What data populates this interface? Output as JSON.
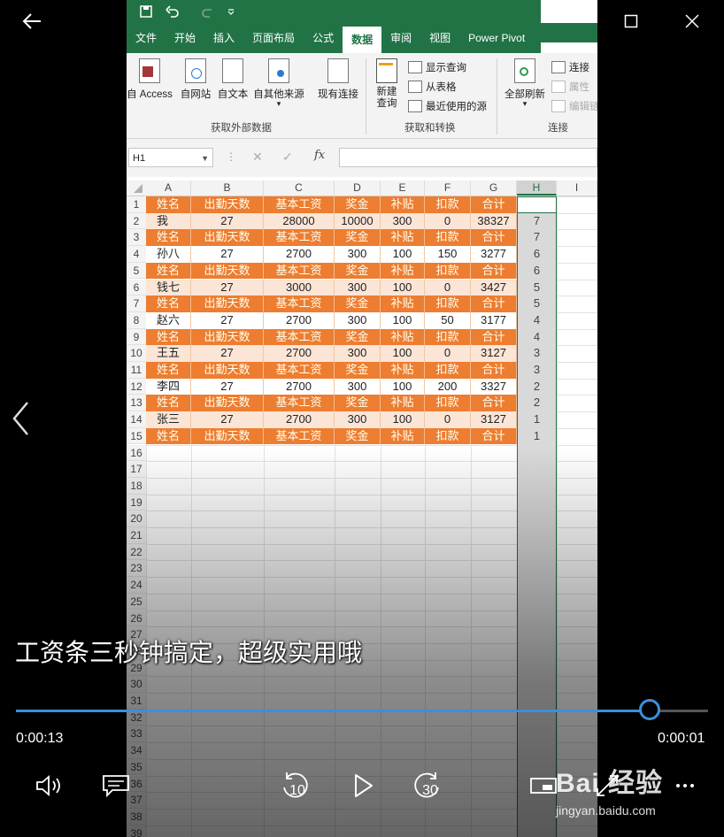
{
  "player": {
    "subtitle": "工资条三秒钟搞定，超级实用哦",
    "elapsed": "0:00:13",
    "remaining": "0:00:01",
    "progress": 0.915,
    "accent_color": "#3a8fdd",
    "skip_back": "10",
    "skip_forward": "30"
  },
  "watermark": {
    "logo": "Bai 经验",
    "url": "jingyan.baidu.com"
  },
  "excel": {
    "tabs": [
      "文件",
      "开始",
      "插入",
      "页面布局",
      "公式",
      "数据",
      "审阅",
      "视图",
      "Power Pivot"
    ],
    "active_tab": "数据",
    "ribbon": {
      "get_external": {
        "buttons": [
          "自 Access",
          "自网站",
          "自文本",
          "自其他来源",
          "现有连接"
        ],
        "title": "获取外部数据"
      },
      "get_transform": {
        "big": "新建\n查询",
        "small": [
          "显示查询",
          "从表格",
          "最近使用的源"
        ],
        "title": "获取和转换"
      },
      "connections": {
        "big": "全部刷新",
        "small": [
          "连接",
          "属性",
          "编辑链接"
        ],
        "title": "连接"
      }
    },
    "name_box": "H1",
    "columns": [
      "A",
      "B",
      "C",
      "D",
      "E",
      "F",
      "G",
      "H",
      "I"
    ],
    "header_fields": [
      "姓名",
      "出勤天数",
      "基本工资",
      "奖金",
      "补贴",
      "扣款",
      "合计"
    ],
    "rows": [
      {
        "n": "1",
        "type": "header",
        "cells": [
          "姓名",
          "出勤天数",
          "基本工资",
          "奖金",
          "补贴",
          "扣款",
          "合计"
        ],
        "h": ""
      },
      {
        "n": "2",
        "type": "data",
        "cells": [
          "我",
          "27",
          "28000",
          "10000",
          "300",
          "0",
          "38327"
        ],
        "h": "7"
      },
      {
        "n": "3",
        "type": "header",
        "cells": [
          "姓名",
          "出勤天数",
          "基本工资",
          "奖金",
          "补贴",
          "扣款",
          "合计"
        ],
        "h": "7"
      },
      {
        "n": "4",
        "type": "data",
        "cells": [
          "孙八",
          "27",
          "2700",
          "300",
          "100",
          "150",
          "3277"
        ],
        "h": "6"
      },
      {
        "n": "5",
        "type": "header",
        "cells": [
          "姓名",
          "出勤天数",
          "基本工资",
          "奖金",
          "补贴",
          "扣款",
          "合计"
        ],
        "h": "6"
      },
      {
        "n": "6",
        "type": "data",
        "cells": [
          "钱七",
          "27",
          "3000",
          "300",
          "100",
          "0",
          "3427"
        ],
        "h": "5"
      },
      {
        "n": "7",
        "type": "header",
        "cells": [
          "姓名",
          "出勤天数",
          "基本工资",
          "奖金",
          "补贴",
          "扣款",
          "合计"
        ],
        "h": "5"
      },
      {
        "n": "8",
        "type": "data",
        "cells": [
          "赵六",
          "27",
          "2700",
          "300",
          "100",
          "50",
          "3177"
        ],
        "h": "4"
      },
      {
        "n": "9",
        "type": "header",
        "cells": [
          "姓名",
          "出勤天数",
          "基本工资",
          "奖金",
          "补贴",
          "扣款",
          "合计"
        ],
        "h": "4"
      },
      {
        "n": "10",
        "type": "data",
        "cells": [
          "王五",
          "27",
          "2700",
          "300",
          "100",
          "0",
          "3127"
        ],
        "h": "3"
      },
      {
        "n": "11",
        "type": "header",
        "cells": [
          "姓名",
          "出勤天数",
          "基本工资",
          "奖金",
          "补贴",
          "扣款",
          "合计"
        ],
        "h": "3"
      },
      {
        "n": "12",
        "type": "data",
        "cells": [
          "李四",
          "27",
          "2700",
          "300",
          "100",
          "200",
          "3327"
        ],
        "h": "2"
      },
      {
        "n": "13",
        "type": "header",
        "cells": [
          "姓名",
          "出勤天数",
          "基本工资",
          "奖金",
          "补贴",
          "扣款",
          "合计"
        ],
        "h": "2"
      },
      {
        "n": "14",
        "type": "data",
        "cells": [
          "张三",
          "27",
          "2700",
          "300",
          "100",
          "0",
          "3127"
        ],
        "h": "1"
      },
      {
        "n": "15",
        "type": "header",
        "cells": [
          "姓名",
          "出勤天数",
          "基本工资",
          "奖金",
          "补贴",
          "扣款",
          "合计"
        ],
        "h": "1"
      }
    ],
    "empty_rows": [
      "16",
      "17",
      "18",
      "19",
      "20",
      "21",
      "22",
      "23",
      "24",
      "25",
      "26",
      "27",
      "28",
      "29",
      "30",
      "31",
      "32",
      "33",
      "34",
      "35",
      "36",
      "37",
      "38",
      "39"
    ],
    "header_color": "#ed7d31",
    "band_color": "#fbe5d6"
  }
}
